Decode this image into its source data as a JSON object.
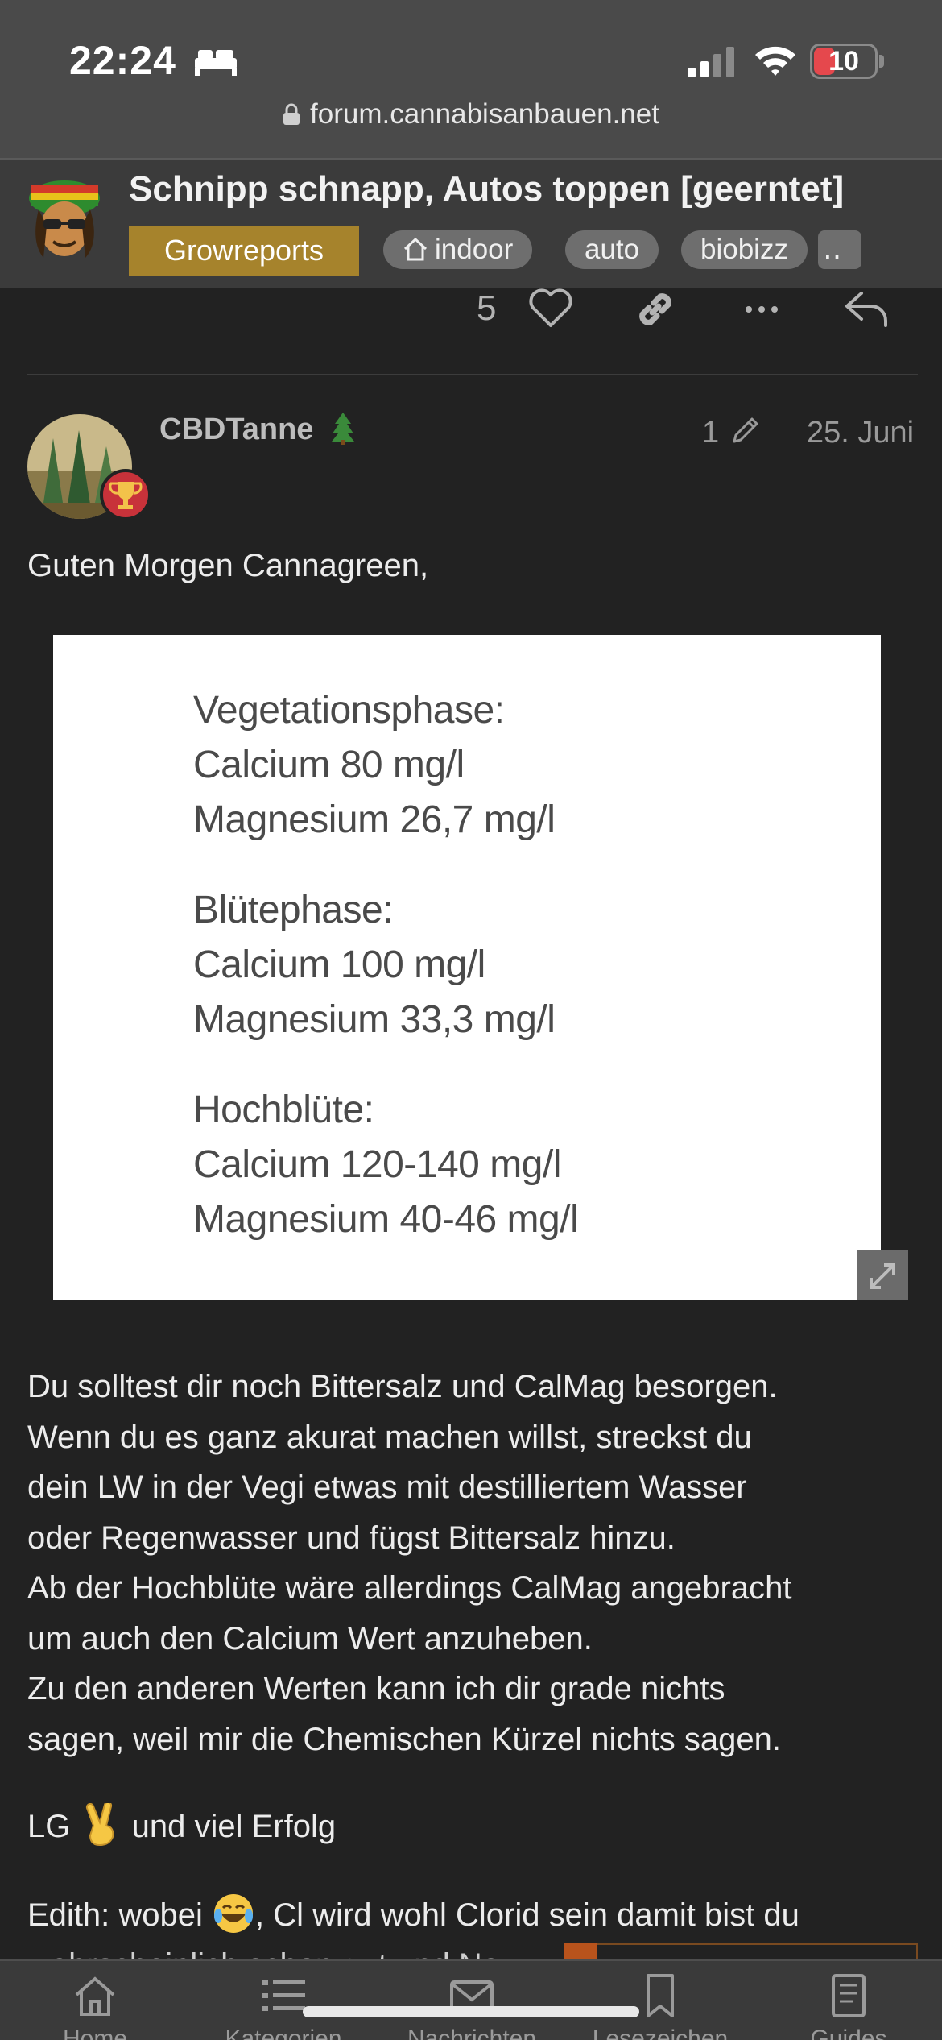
{
  "status_bar": {
    "time": "22:24",
    "battery": "10",
    "icons": [
      "bed-icon",
      "signal-icon",
      "wifi-icon",
      "battery-icon"
    ]
  },
  "browser": {
    "url": "forum.cannabisanbauen.net",
    "lock_icon": "lock-icon"
  },
  "topic": {
    "title": "Schnipp schnapp, Autos toppen [geerntet]",
    "category": "Growreports",
    "category_color": "#a6832c",
    "tags": [
      "indoor",
      "auto",
      "biobizz"
    ],
    "tags_more": "‥"
  },
  "previous_post_actions": {
    "like_count": "5",
    "icons": [
      "heart-icon",
      "link-icon",
      "more-icon",
      "reply-icon"
    ]
  },
  "post": {
    "username": "CBDTanne",
    "username_icon": "tree-icon",
    "badge_icon": "trophy-icon",
    "badge_color": "#c8323a",
    "edit_count": "1",
    "date": "25. Juni",
    "greeting": "Guten Morgen Cannagreen,",
    "image_text": [
      {
        "heading": "Vegetationsphase:",
        "lines": [
          "Calcium 80 mg/l",
          "Magnesium 26,7 mg/l"
        ]
      },
      {
        "heading": "Blütephase:",
        "lines": [
          "Calcium 100 mg/l",
          "Magnesium 33,3 mg/l"
        ]
      },
      {
        "heading": "Hochblüte:",
        "lines": [
          "Calcium 120-140 mg/l",
          "Magnesium 40-46 mg/l"
        ]
      }
    ],
    "body_lines": [
      "Du solltest dir noch Bittersalz und CalMag besorgen.",
      "Wenn du es ganz akurat machen willst, streckst du",
      "dein LW in der Vegi etwas mit destilliertem Wasser",
      "oder Regenwasser und fügst Bittersalz hinzu.",
      "Ab der Hochblüte wäre allerdings CalMag angebracht",
      "um auch den Calcium Wert anzuheben.",
      "Zu den anderen Werten kann ich dir grade nichts",
      "sagen, weil mir die Chemischen Kürzel nichts sagen."
    ],
    "lg_prefix": "LG",
    "lg_suffix": "und viel Erfolg",
    "edith_prefix": "Edith: wobei",
    "edith_suffix": ", Cl wird wohl Clorid sein damit bist du",
    "partial_line": "wahrscheinlich schon gut und Na Na"
  },
  "bottom_nav": [
    {
      "label": "Home",
      "icon": "home-icon"
    },
    {
      "label": "Kategorien",
      "icon": "list-icon"
    },
    {
      "label": "Nachrichten",
      "icon": "mail-icon"
    },
    {
      "label": "Lesezeichen",
      "icon": "bookmark-icon"
    },
    {
      "label": "Guides",
      "icon": "book-icon"
    }
  ]
}
